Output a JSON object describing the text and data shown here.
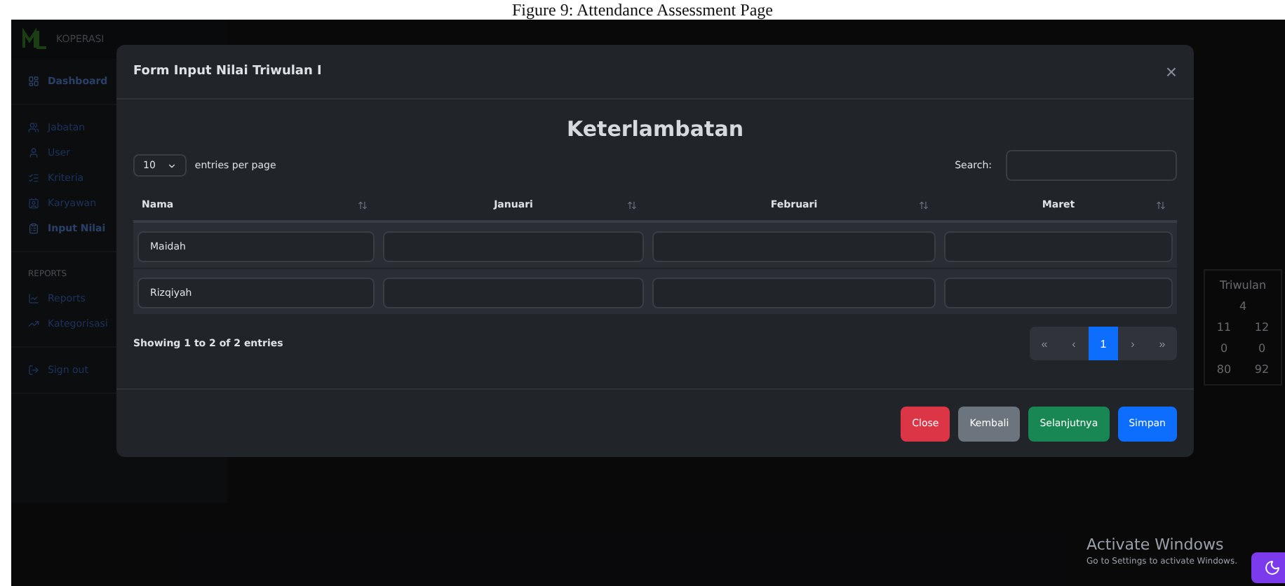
{
  "caption": "Figure 9: Attendance Assessment Page",
  "brand": "KOPERASI",
  "sidebar": {
    "top": [
      {
        "label": "Dashboard",
        "selected": true
      }
    ],
    "items": [
      {
        "label": "Jabatan",
        "selected": false
      },
      {
        "label": "User",
        "selected": false
      },
      {
        "label": "Kriteria",
        "selected": false
      },
      {
        "label": "Karyawan",
        "selected": false
      },
      {
        "label": "Input Nilai",
        "selected": true
      }
    ],
    "section": "REPORTS",
    "reports": [
      {
        "label": "Reports",
        "selected": false
      },
      {
        "label": "Kategorisasi",
        "selected": false
      }
    ],
    "signout": "Sign out"
  },
  "background_table": {
    "header": [
      "Triwulan",
      "4"
    ],
    "rows": [
      [
        "11",
        "12"
      ],
      [
        "0",
        "0"
      ],
      [
        "80",
        "92"
      ]
    ]
  },
  "modal": {
    "title": "Form Input Nilai Triwulan I",
    "close": "×",
    "heading": "Keterlambatan",
    "per_page": "10",
    "per_page_label": "entries per page",
    "search_label": "Search:",
    "columns": [
      "Nama",
      "Januari",
      "Februari",
      "Maret"
    ],
    "rows": [
      {
        "name": "Maidah"
      },
      {
        "name": "Rizqiyah"
      }
    ],
    "info": "Showing 1 to 2 of 2 entries",
    "pages": [
      {
        "label": "«",
        "selected": false
      },
      {
        "label": "‹",
        "selected": false
      },
      {
        "label": "1",
        "selected": true
      },
      {
        "label": "›",
        "selected": false
      },
      {
        "label": "»",
        "selected": false
      }
    ],
    "buttons": [
      {
        "label": "Close",
        "kind": "danger"
      },
      {
        "label": "Kembali",
        "kind": "secondary"
      },
      {
        "label": "Selanjutnya",
        "kind": "success"
      },
      {
        "label": "Simpan",
        "kind": "primary"
      }
    ]
  },
  "os_notice": {
    "title": "Activate Windows",
    "text": "Go to Settings to activate Windows."
  }
}
